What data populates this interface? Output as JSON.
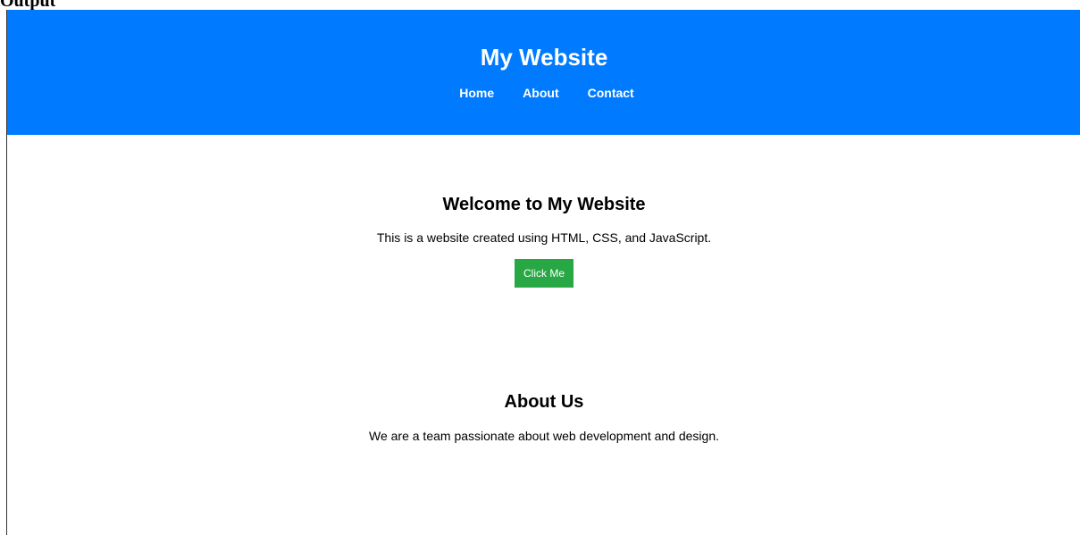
{
  "corner_label": "Output",
  "header": {
    "title": "My Website",
    "nav": [
      "Home",
      "About",
      "Contact"
    ]
  },
  "welcome": {
    "heading": "Welcome to My Website",
    "text": "This is a website created using HTML, CSS, and JavaScript.",
    "button_label": "Click Me"
  },
  "about": {
    "heading": "About Us",
    "text": "We are a team passionate about web development and design."
  },
  "colors": {
    "header_bg": "#007bff",
    "button_bg": "#28a745"
  }
}
